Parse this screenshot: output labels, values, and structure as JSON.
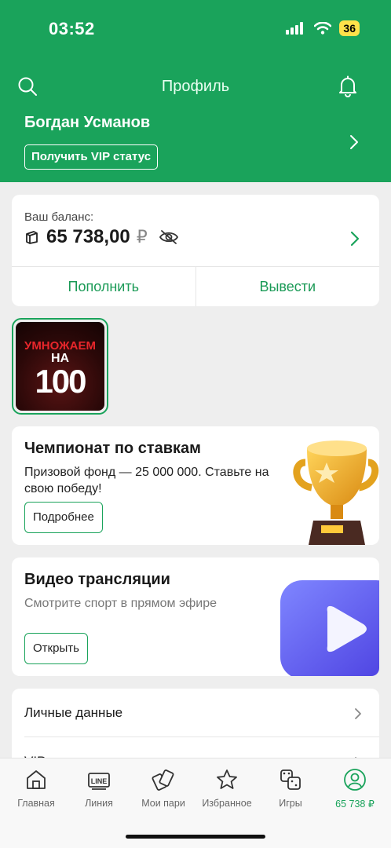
{
  "status_bar": {
    "time": "03:52",
    "battery": "36"
  },
  "header": {
    "title": "Профиль",
    "user_name": "Богдан Усманов",
    "vip_button": "Получить VIP статус"
  },
  "balance": {
    "label": "Ваш баланс:",
    "value": "65 738,00",
    "currency": "₽",
    "deposit_label": "Пополнить",
    "withdraw_label": "Вывести"
  },
  "promo_story": {
    "line1": "УМНОЖАЕМ",
    "line2": "НА",
    "line3": "100"
  },
  "championship": {
    "title": "Чемпионат по ставкам",
    "description": "Призовой фонд — 25 000 000. Ставьте на свою победу!",
    "button": "Подробнее"
  },
  "video": {
    "title": "Видео трансляции",
    "description": "Смотрите спорт в прямом эфире",
    "button": "Открыть"
  },
  "menu": {
    "items": [
      "Личные данные",
      "VIP"
    ]
  },
  "tabbar": {
    "items": [
      {
        "label": "Главная",
        "icon": "home-icon"
      },
      {
        "label": "Линия",
        "icon": "line-icon"
      },
      {
        "label": "Мои пари",
        "icon": "tickets-icon"
      },
      {
        "label": "Избранное",
        "icon": "star-icon"
      },
      {
        "label": "Игры",
        "icon": "dice-icon"
      },
      {
        "label": "65 738 ₽",
        "icon": "profile-icon"
      }
    ],
    "active": 5
  },
  "colors": {
    "brand": "#1aa35b",
    "accent_text": "#1a9a56",
    "promo_red": "#e8262b"
  }
}
